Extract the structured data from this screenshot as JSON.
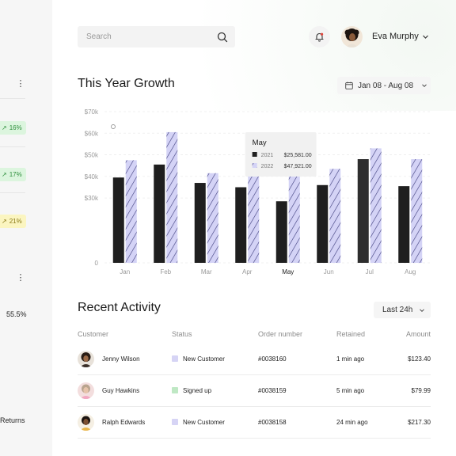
{
  "left_panel": {
    "pills": [
      {
        "label": "16%",
        "tone": "green"
      },
      {
        "label": "17%",
        "tone": "green"
      },
      {
        "label": "21%",
        "tone": "yellow"
      }
    ],
    "stat_value": "55.5%",
    "returns_label": "Returns"
  },
  "header": {
    "search_placeholder": "Search",
    "user_name": "Eva Murphy"
  },
  "growth": {
    "title": "This Year Growth",
    "date_range": "Jan 08 - Aug 08"
  },
  "chart_data": {
    "type": "bar",
    "categories": [
      "Jan",
      "Feb",
      "Mar",
      "Apr",
      "May",
      "Jun",
      "Jul",
      "Aug"
    ],
    "series": [
      {
        "name": "2021",
        "values": [
          39500,
          45500,
          37000,
          35000,
          28500,
          36000,
          48000,
          35500
        ],
        "color": "#1f1f1f"
      },
      {
        "name": "2022",
        "values": [
          47500,
          60500,
          41500,
          43000,
          46000,
          43500,
          53000,
          48000
        ],
        "color": "#c9c9f2"
      }
    ],
    "y_ticks": [
      "0",
      "$30k",
      "$40k",
      "$50k",
      "$60k",
      "$70k"
    ],
    "y_tick_values": [
      0,
      30000,
      40000,
      50000,
      60000,
      70000
    ],
    "ylim": [
      0,
      70000
    ],
    "highlight_category": "May",
    "tooltip": {
      "title": "May",
      "rows": [
        {
          "label": "2021",
          "value": "$25,581.00"
        },
        {
          "label": "2022",
          "value": "$47,921.00"
        }
      ]
    },
    "grid": true
  },
  "recent": {
    "title": "Recent Activity",
    "filter": "Last 24h",
    "columns": [
      "Customer",
      "Status",
      "Order number",
      "Retained",
      "Amount"
    ],
    "rows": [
      {
        "customer": "Jenny Wilson",
        "status": "New Customer",
        "status_color": "#d6d4f5",
        "order": "#0038160",
        "retained": "1 min ago",
        "amount": "$123.40"
      },
      {
        "customer": "Guy Hawkins",
        "status": "Signed up",
        "status_color": "#bfe8c4",
        "order": "#0038159",
        "retained": "5 min ago",
        "amount": "$79.99"
      },
      {
        "customer": "Ralph Edwards",
        "status": "New Customer",
        "status_color": "#d6d4f5",
        "order": "#0038158",
        "retained": "24 min ago",
        "amount": "$217.30"
      }
    ]
  }
}
